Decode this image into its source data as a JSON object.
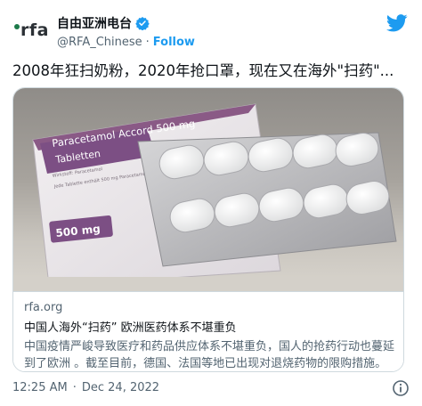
{
  "header": {
    "logo_text": "rfa",
    "display_name": "自由亚洲电台",
    "handle": "@RFA_Chinese",
    "separator": "·",
    "follow_label": "Follow"
  },
  "tweet": {
    "text": "2008年狂扫奶粉，2020年抢口罩，现在又在海外\"扫药\"..."
  },
  "card": {
    "image_text": {
      "product_line1": "Paracetamol Accord 500 mg",
      "product_line2": "Tabletten",
      "dose_badge": "500 mg",
      "fine_print1": "Wirkstoff: Paracetamol",
      "fine_print2": "Jede Tablette enthält 500 mg Paracetamol"
    },
    "domain": "rfa.org",
    "title": "中国人海外“扫药” 欧洲医药体系不堪重负",
    "description": "中国疫情严峻导致医疗和药品供应体系不堪重负，国人的抢药行动也蔓延到了欧洲 。截至目前，德国、法国等地已出现对退烧药物的限购措施。"
  },
  "footer": {
    "time": "12:25 AM",
    "separator": "·",
    "date": "Dec 24, 2022"
  },
  "colors": {
    "accent": "#1d9bf0",
    "text": "#0f1419",
    "muted": "#536471",
    "border": "#cfd9de"
  },
  "icons": {
    "verified": "verified-badge-icon",
    "brand": "twitter-bird-icon",
    "info": "info-icon"
  }
}
